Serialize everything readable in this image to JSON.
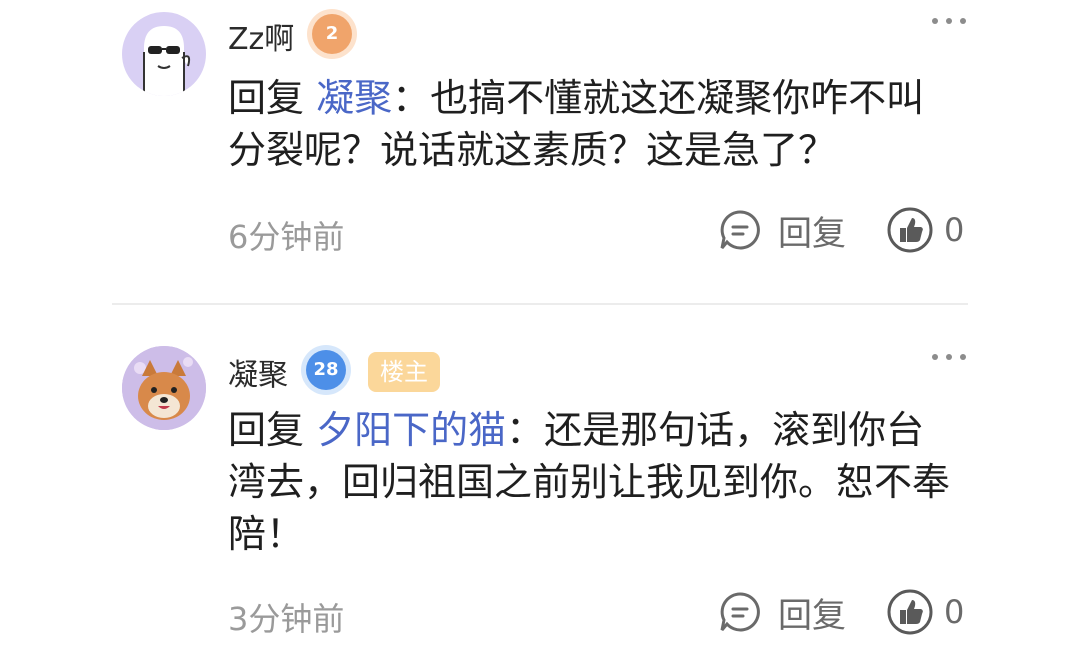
{
  "comments": [
    {
      "username": "Zz啊",
      "level": "2",
      "reply_prefix": "回复 ",
      "mention": "凝聚",
      "text": "：也搞不懂就这还凝聚你咋不叫分裂呢？说话就这素质？这是急了？",
      "time": "6分钟前",
      "reply_label": "回复",
      "likes": "0",
      "avatar_icon": "sunglasses-ghost-avatar",
      "level_color": "#f0a46b"
    },
    {
      "username": "凝聚",
      "level": "28",
      "owner_badge": "楼主",
      "reply_prefix": "回复 ",
      "mention": "夕阳下的猫",
      "text": "：还是那句话，滚到你台湾去，回归祖国之前别让我见到你。恕不奉陪！",
      "time": "3分钟前",
      "reply_label": "回复",
      "likes": "0",
      "avatar_icon": "shiba-dog-avatar",
      "level_color": "#4d8fe8"
    }
  ],
  "colors": {
    "mention": "#4a67c7",
    "owner_badge_bg": "#fbd79a",
    "meta_text": "#9a9a9a"
  }
}
